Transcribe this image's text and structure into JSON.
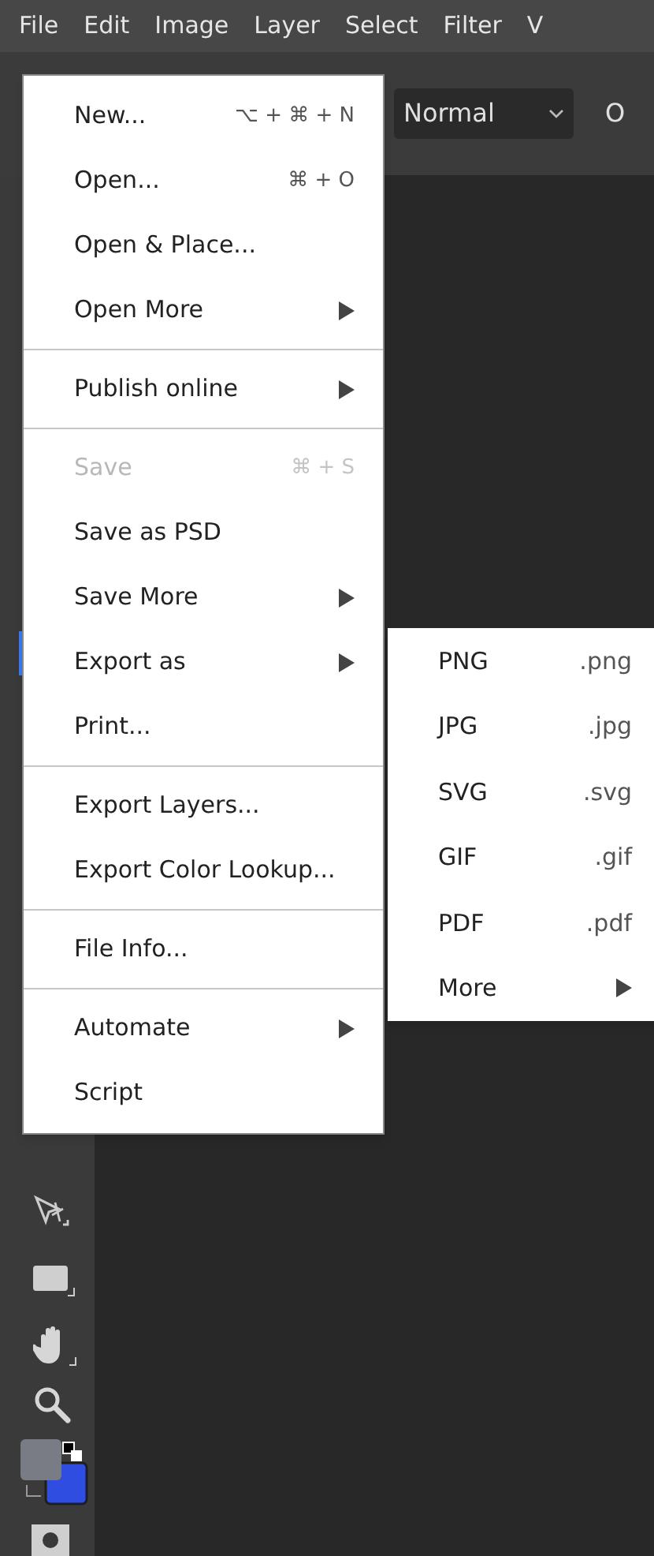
{
  "menubar": [
    "File",
    "Edit",
    "Image",
    "Layer",
    "Select",
    "Filter",
    "V"
  ],
  "options_bar": {
    "blend_mode": "Normal",
    "cut_label": "O"
  },
  "file_menu": [
    {
      "kind": "item",
      "label": "New...",
      "shortcut": "⌥ + ⌘ + N",
      "disabled": false
    },
    {
      "kind": "item",
      "label": "Open...",
      "shortcut": "⌘ + O",
      "disabled": false
    },
    {
      "kind": "item",
      "label": "Open & Place...",
      "disabled": false,
      "submenu": false
    },
    {
      "kind": "item",
      "label": "Open More",
      "disabled": false,
      "submenu": true
    },
    {
      "kind": "separator"
    },
    {
      "kind": "item",
      "label": "Publish online",
      "disabled": false,
      "submenu": true
    },
    {
      "kind": "separator"
    },
    {
      "kind": "item",
      "label": "Save",
      "shortcut": "⌘ + S",
      "disabled": true
    },
    {
      "kind": "item",
      "label": "Save as PSD",
      "disabled": false,
      "submenu": false
    },
    {
      "kind": "item",
      "label": "Save More",
      "disabled": false,
      "submenu": true
    },
    {
      "kind": "item",
      "label": "Export as",
      "disabled": false,
      "submenu": true
    },
    {
      "kind": "item",
      "label": "Print...",
      "disabled": false,
      "submenu": false
    },
    {
      "kind": "separator"
    },
    {
      "kind": "item",
      "label": "Export Layers...",
      "disabled": false,
      "submenu": false
    },
    {
      "kind": "item",
      "label": "Export Color Lookup...",
      "disabled": false,
      "submenu": false
    },
    {
      "kind": "separator"
    },
    {
      "kind": "item",
      "label": "File Info...",
      "disabled": false,
      "submenu": false
    },
    {
      "kind": "separator"
    },
    {
      "kind": "item",
      "label": "Automate",
      "disabled": false,
      "submenu": true
    },
    {
      "kind": "item",
      "label": "Script",
      "disabled": false,
      "submenu": false
    }
  ],
  "export_submenu": [
    {
      "label": "PNG",
      "extension": ".png",
      "submenu": false
    },
    {
      "label": "JPG",
      "extension": ".jpg",
      "submenu": false
    },
    {
      "label": "SVG",
      "extension": ".svg",
      "submenu": false
    },
    {
      "label": "GIF",
      "extension": ".gif",
      "submenu": false
    },
    {
      "label": "PDF",
      "extension": ".pdf",
      "submenu": false
    },
    {
      "label": "More",
      "submenu": true
    }
  ]
}
